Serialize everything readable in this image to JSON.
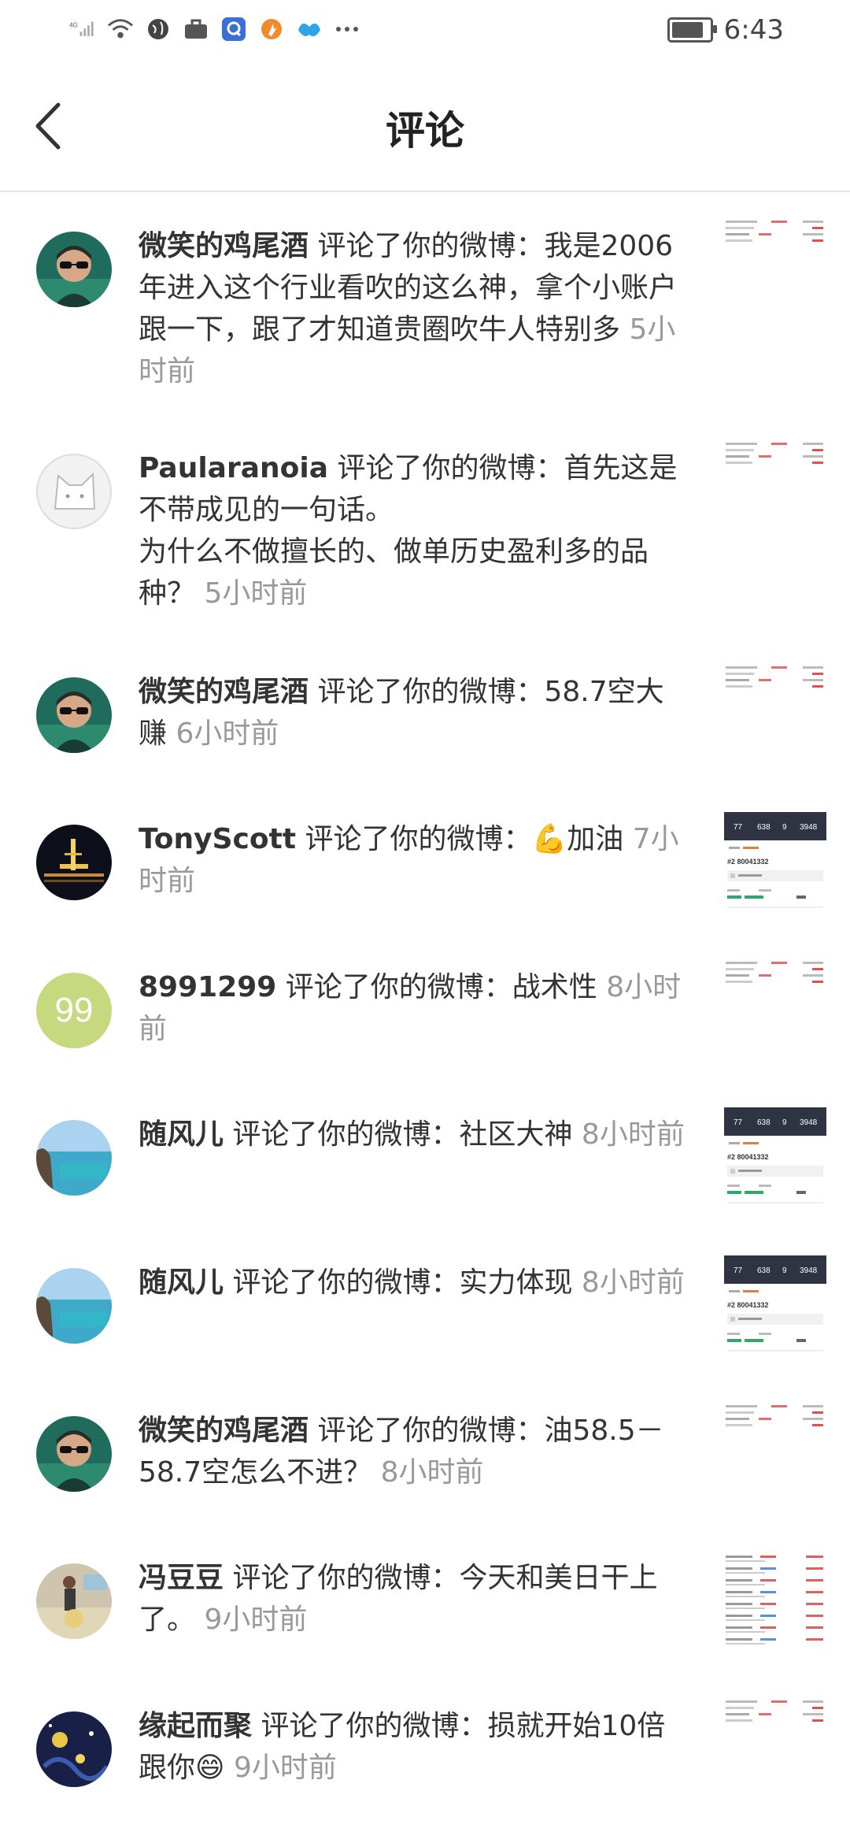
{
  "status_bar": {
    "network": "4G",
    "time": "6:43",
    "battery_level": 0.85
  },
  "header": {
    "title": "评论"
  },
  "comments": [
    {
      "user": "微笑的鸡尾酒",
      "action": " 评论了你的微博：",
      "text": "我是2006年进入这个行业看吹的这么神，拿个小账户跟一下，跟了才知道贵圈吹牛人特别多 ",
      "time": "5小时前",
      "avatar": "man-sunglasses",
      "thumb": "trade-list"
    },
    {
      "user": "Paularanoia",
      "action": " 评论了你的微博：",
      "text": "首先这是不带成见的一句话。\n为什么不做擅长的、做单历史盈利多的品种？ ",
      "time": "5小时前",
      "avatar": "default-cat",
      "thumb": "trade-list"
    },
    {
      "user": "微笑的鸡尾酒",
      "action": " 评论了你的微博：",
      "text": "58.7空大赚 ",
      "time": "6小时前",
      "avatar": "man-sunglasses",
      "thumb": "trade-list"
    },
    {
      "user": "TonyScott",
      "action": " 评论了你的微博：",
      "text": "💪加油 ",
      "time": "7小时前",
      "avatar": "night-city",
      "thumb": "account-card"
    },
    {
      "user": "8991299",
      "action": " 评论了你的微博：",
      "text": "战术性 ",
      "time": "8小时前",
      "avatar": "number-99",
      "thumb": "trade-list"
    },
    {
      "user": "随风儿",
      "action": " 评论了你的微博：",
      "text": "社区大神 ",
      "time": "8小时前",
      "avatar": "sea-cliff",
      "thumb": "account-card"
    },
    {
      "user": "随风儿",
      "action": " 评论了你的微博：",
      "text": "实力体现 ",
      "time": "8小时前",
      "avatar": "sea-cliff",
      "thumb": "account-card"
    },
    {
      "user": "微笑的鸡尾酒",
      "action": " 评论了你的微博：",
      "text": "油58.5－58.7空怎么不进？ ",
      "time": "8小时前",
      "avatar": "man-sunglasses",
      "thumb": "trade-list"
    },
    {
      "user": "冯豆豆",
      "action": " 评论了你的微博：",
      "text": "今天和美日干上了。 ",
      "time": "9小时前",
      "avatar": "person-beach",
      "thumb": "trade-list-long"
    },
    {
      "user": "缘起而聚",
      "action": " 评论了你的微博：",
      "text": "损就开始10倍跟你😄 ",
      "time": "9小时前",
      "avatar": "starry-night",
      "thumb": "trade-list"
    }
  ],
  "avatar_text": {
    "number-99": "99"
  },
  "account_card": {
    "stats": [
      "77",
      "638",
      "9",
      "3948"
    ],
    "account": "#2 80041332"
  }
}
